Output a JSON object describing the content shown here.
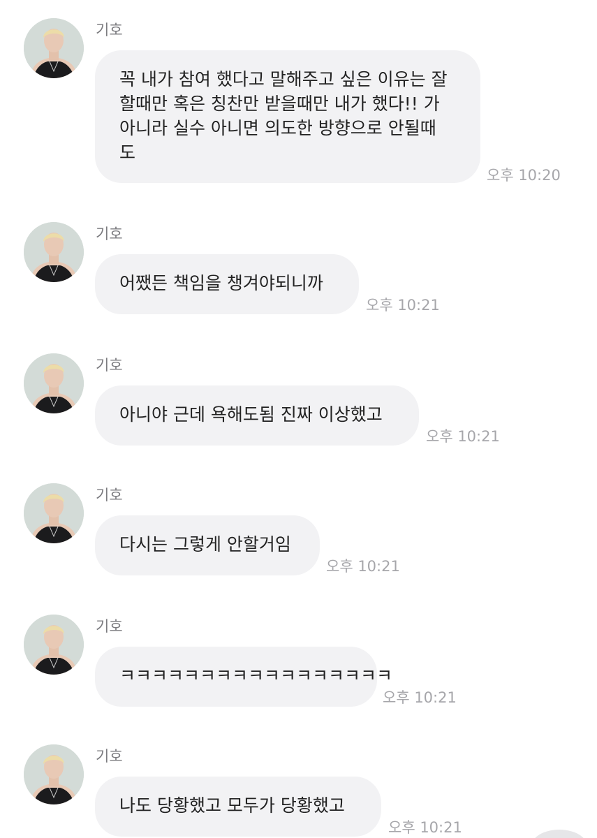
{
  "messages": [
    {
      "sender": "기호",
      "lines": [
        "꼭 내가 참여 했다고 말해주고 싶은 이유는 잘",
        "할때만 혹은 칭찬만 받을때만 내가 했다!! 가",
        "아니라 실수 아니면 의도한 방향으로 안될때",
        "도"
      ],
      "time": "오후 10:20"
    },
    {
      "sender": "기호",
      "lines": [
        "어쨌든 책임을 챙겨야되니까"
      ],
      "time": "오후 10:21"
    },
    {
      "sender": "기호",
      "lines": [
        "아니야 근데 욕해도됨 진짜 이상했고"
      ],
      "time": "오후 10:21"
    },
    {
      "sender": "기호",
      "lines": [
        "다시는 그렇게 안할거임"
      ],
      "time": "오후 10:21"
    },
    {
      "sender": "기호",
      "lines": [
        "ㅋㅋㅋㅋㅋㅋㅋㅋㅋㅋㅋㅋㅋㅋㅋㅋㅋ"
      ],
      "time": "오후 10:21"
    },
    {
      "sender": "기호",
      "lines": [
        "나도 당황했고 모두가 당황했고"
      ],
      "time": "오후 10:21"
    }
  ]
}
